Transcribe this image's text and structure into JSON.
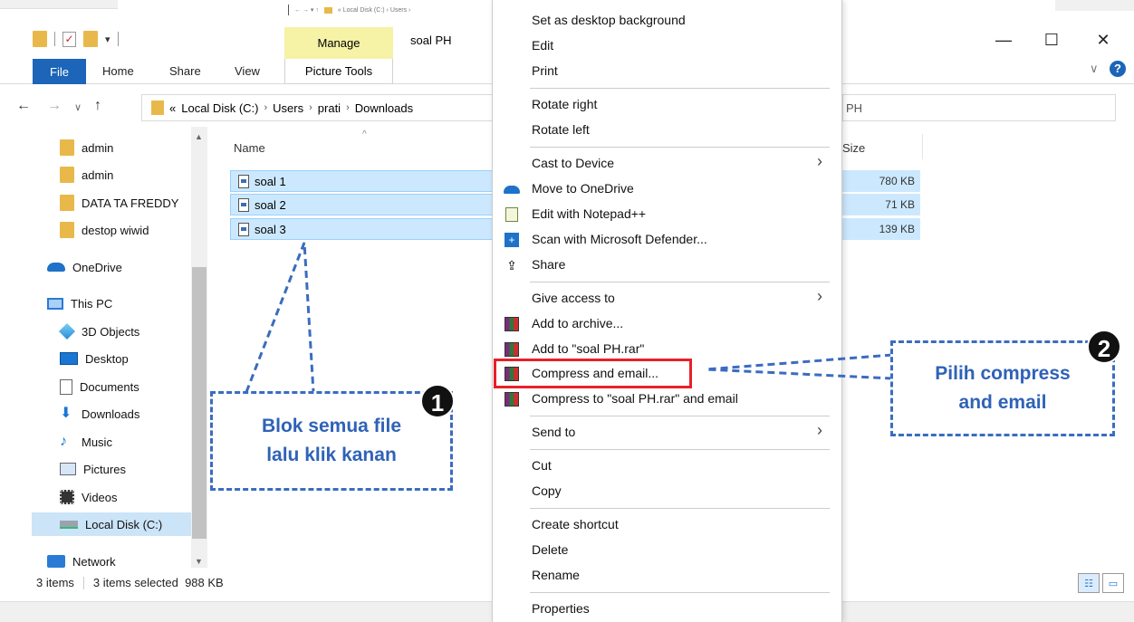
{
  "window": {
    "title": "soal PH",
    "manage_tab": "Manage",
    "picture_tools": "Picture Tools",
    "minimize": "—",
    "maximize": "☐",
    "close": "✕",
    "mini_path": "« Local Disk (C:) › Users ›"
  },
  "ribbon": {
    "file": "File",
    "home": "Home",
    "share": "Share",
    "view": "View",
    "help": "?"
  },
  "address": {
    "overflow": "«",
    "crumbs": [
      "Local Disk (C:)",
      "Users",
      "prati",
      "Downloads"
    ],
    "separator": "›",
    "search_text": "PH"
  },
  "sidebar": {
    "items": [
      {
        "label": "admin"
      },
      {
        "label": "admin"
      },
      {
        "label": "DATA TA FREDDY"
      },
      {
        "label": "destop wiwid"
      },
      {
        "label": "OneDrive"
      },
      {
        "label": "This PC"
      },
      {
        "label": "3D Objects"
      },
      {
        "label": "Desktop"
      },
      {
        "label": "Documents"
      },
      {
        "label": "Downloads"
      },
      {
        "label": "Music"
      },
      {
        "label": "Pictures"
      },
      {
        "label": "Videos"
      },
      {
        "label": "Local Disk (C:)"
      },
      {
        "label": "Network"
      }
    ]
  },
  "files": {
    "col_name": "Name",
    "col_size": "Size",
    "rows": [
      {
        "name": "soal 1",
        "size": "780 KB"
      },
      {
        "name": "soal 2",
        "size": "71 KB"
      },
      {
        "name": "soal 3",
        "size": "139 KB"
      }
    ]
  },
  "status": {
    "items": "3 items",
    "selected": "3 items selected  988 KB"
  },
  "context_menu": {
    "items": [
      {
        "label": "Set as desktop background",
        "icon": ""
      },
      {
        "label": "Edit",
        "icon": ""
      },
      {
        "label": "Print",
        "icon": ""
      },
      {
        "label": "Rotate right",
        "icon": ""
      },
      {
        "label": "Rotate left",
        "icon": ""
      },
      {
        "label": "Cast to Device",
        "icon": ""
      },
      {
        "label": "Move to OneDrive",
        "icon": "onedrive-icon"
      },
      {
        "label": "Edit with Notepad++",
        "icon": "notepad-icon"
      },
      {
        "label": "Scan with Microsoft Defender...",
        "icon": "defender-icon"
      },
      {
        "label": "Share",
        "icon": "share-icon"
      },
      {
        "label": "Give access to",
        "icon": ""
      },
      {
        "label": "Add to archive...",
        "icon": "winrar-icon"
      },
      {
        "label": "Add to \"soal PH.rar\"",
        "icon": "winrar-icon"
      },
      {
        "label": "Compress and email...",
        "icon": "winrar-icon"
      },
      {
        "label": "Compress to \"soal PH.rar\" and email",
        "icon": "winrar-icon"
      },
      {
        "label": "Send to",
        "icon": ""
      },
      {
        "label": "Cut",
        "icon": ""
      },
      {
        "label": "Copy",
        "icon": ""
      },
      {
        "label": "Create shortcut",
        "icon": ""
      },
      {
        "label": "Delete",
        "icon": ""
      },
      {
        "label": "Rename",
        "icon": ""
      },
      {
        "label": "Properties",
        "icon": ""
      }
    ],
    "submenu_arrow": "›"
  },
  "annotations": {
    "callout1_line1": "Blok semua file",
    "callout1_line2": "lalu klik kanan",
    "badge1": "1",
    "callout2_line1": "Pilih compress",
    "callout2_line2": "and email",
    "badge2": "2",
    "color": "#2f62b8",
    "highlight_color": "#e8202a"
  }
}
